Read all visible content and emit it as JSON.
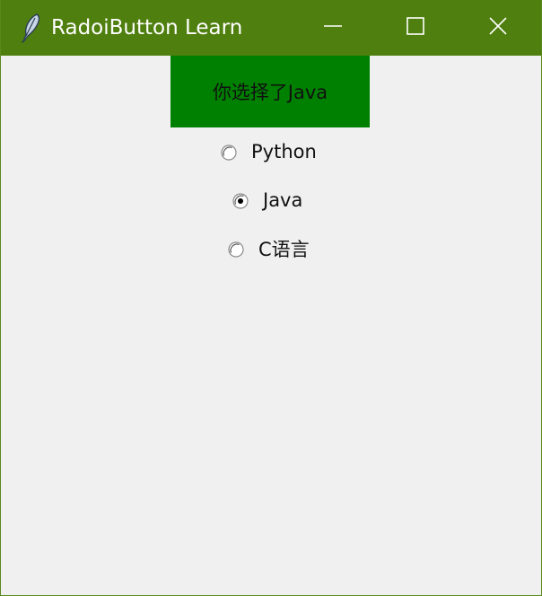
{
  "window": {
    "title": "RadoiButton Learn",
    "icon": "feather-icon",
    "titlebar_color": "#4f7f0e",
    "controls": {
      "minimize": "minimize-icon",
      "maximize": "maximize-icon",
      "close": "close-icon"
    }
  },
  "result_label": {
    "text": "你选择了Java",
    "background": "#008000"
  },
  "radio_group": {
    "selected": "Java",
    "options": [
      {
        "label": "Python",
        "checked": false
      },
      {
        "label": "Java",
        "checked": true
      },
      {
        "label": "C语言",
        "checked": false
      }
    ]
  }
}
